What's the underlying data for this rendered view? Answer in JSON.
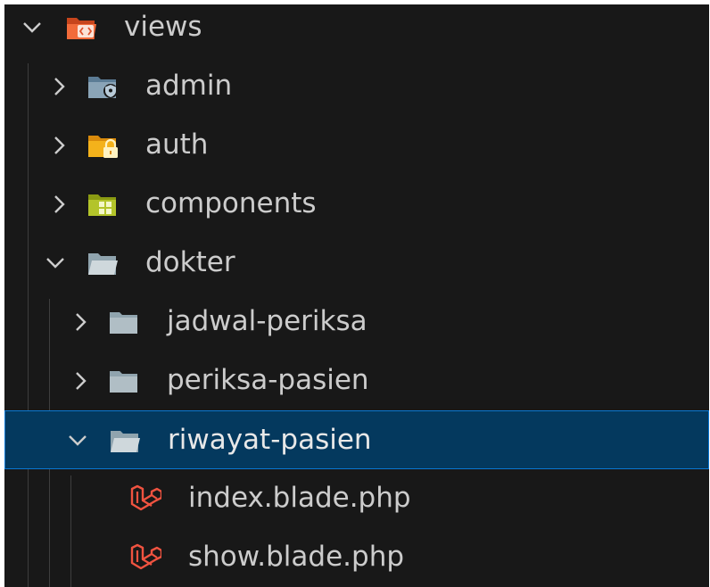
{
  "explorer": {
    "root": {
      "label": "views",
      "icon": "views-folder-open-icon",
      "expanded": true
    },
    "items": [
      {
        "label": "admin",
        "icon": "admin-folder-icon",
        "expanded": false
      },
      {
        "label": "auth",
        "icon": "auth-folder-icon",
        "expanded": false
      },
      {
        "label": "components",
        "icon": "components-folder-icon",
        "expanded": false
      },
      {
        "label": "dokter",
        "icon": "folder-open-icon",
        "expanded": true,
        "children": [
          {
            "label": "jadwal-periksa",
            "icon": "folder-icon",
            "expanded": false
          },
          {
            "label": "periksa-pasien",
            "icon": "folder-icon",
            "expanded": false
          },
          {
            "label": "riwayat-pasien",
            "icon": "folder-open-icon",
            "expanded": true,
            "selected": true,
            "children": [
              {
                "label": "index.blade.php",
                "icon": "laravel-blade-icon"
              },
              {
                "label": "show.blade.php",
                "icon": "laravel-blade-icon"
              }
            ]
          }
        ]
      }
    ]
  },
  "colors": {
    "background": "#181818",
    "text": "#cccccc",
    "selection_bg": "#04395e",
    "selection_border": "#0a78d4",
    "laravel_red": "#f05340"
  }
}
